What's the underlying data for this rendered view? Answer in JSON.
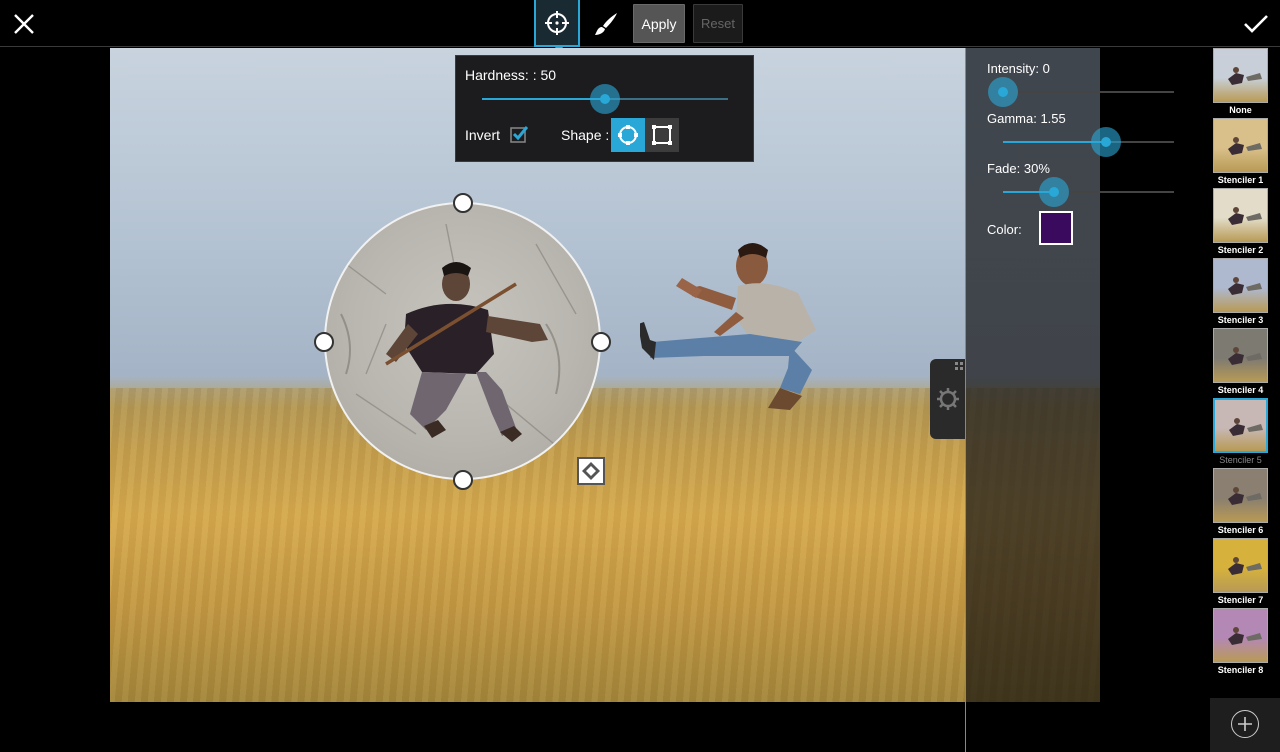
{
  "toolbar": {
    "apply_label": "Apply",
    "reset_label": "Reset",
    "active_tool": "target-icon"
  },
  "hardness_popup": {
    "hardness_label": "Hardness: : 50",
    "hardness_value": 50,
    "invert_label": "Invert",
    "invert_checked": true,
    "shape_label": "Shape :",
    "shape_selected": "circle"
  },
  "settings": {
    "intensity_label": "Intensity: 0",
    "intensity_value": 0,
    "gamma_label": "Gamma: 1.55",
    "gamma_fraction": 0.6,
    "fade_label": "Fade: 30%",
    "fade_value": 30,
    "color_label": "Color:",
    "color_value": "#3a0a5e"
  },
  "stencils": [
    {
      "label": "None",
      "tint": "#c8cfd8"
    },
    {
      "label": "Stenciler 1",
      "tint": "#d9c08a"
    },
    {
      "label": "Stenciler 2",
      "tint": "#e2dcc8"
    },
    {
      "label": "Stenciler 3",
      "tint": "#aeb8cf"
    },
    {
      "label": "Stenciler 4",
      "tint": "#7d7a72"
    },
    {
      "label": "Stenciler 5",
      "tint": "#c7b8b6"
    },
    {
      "label": "Stenciler 6",
      "tint": "#8a7f70"
    },
    {
      "label": "Stenciler 7",
      "tint": "#d6b23c"
    },
    {
      "label": "Stenciler 8",
      "tint": "#b488b4"
    }
  ],
  "active_stencil": "Stenciler 5",
  "colors": {
    "accent": "#29a8d8"
  }
}
